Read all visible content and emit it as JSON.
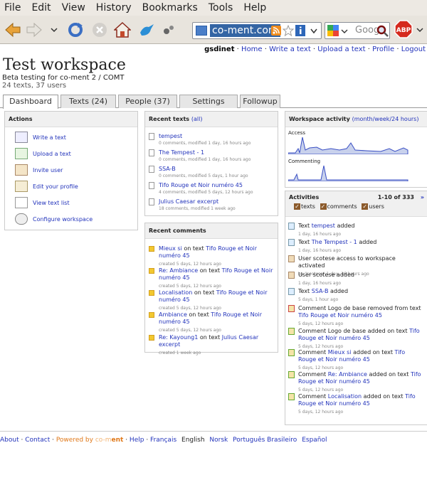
{
  "menu": [
    "File",
    "Edit",
    "View",
    "History",
    "Bookmarks",
    "Tools",
    "Help"
  ],
  "url": "co-ment.com",
  "search_placeholder": "Goog",
  "user": {
    "name": "gsdinet",
    "links": [
      "Home",
      "Write a text",
      "Upload a text",
      "Profile",
      "Logout"
    ]
  },
  "workspace": {
    "title": "Test workspace",
    "description": "Beta testing for co-ment 2 / COMT",
    "stats": "24 texts, 37 users"
  },
  "tabs": [
    "Dashboard",
    "Texts (24)",
    "People (37)",
    "Settings",
    "Followup"
  ],
  "actions": {
    "title": "Actions",
    "items": [
      "Write a text",
      "Upload a text",
      "Invite user",
      "Edit your profile",
      "View text list",
      "Configure workspace"
    ]
  },
  "recent_texts": {
    "title": "Recent texts",
    "all_link": "(all)",
    "items": [
      {
        "title": "tempest",
        "meta": "0 comments, modified 1 day, 16 hours ago"
      },
      {
        "title": "The Tempest - 1",
        "meta": "0 comments, modified 1 day, 16 hours ago"
      },
      {
        "title": "SSA-B",
        "meta": "0 comments, modified 5 days, 1 hour ago"
      },
      {
        "title": "Tifo Rouge et Noir numéro 45",
        "meta": "4 comments, modified 5 days, 12 hours ago"
      },
      {
        "title": "Julius Caesar excerpt",
        "meta": "18 comments, modified 1 week ago"
      }
    ]
  },
  "recent_comments": {
    "title": "Recent comments",
    "items": [
      {
        "comment": "Mieux si",
        "text": "Tifo Rouge et Noir numéro 45",
        "meta": "created 5 days, 12 hours ago"
      },
      {
        "comment": "Re: Ambiance",
        "text": "Tifo Rouge et Noir numéro 45",
        "meta": "created 5 days, 12 hours ago"
      },
      {
        "comment": "Localisation",
        "text": "Tifo Rouge et Noir numéro 45",
        "meta": "created 5 days, 12 hours ago"
      },
      {
        "comment": "Ambiance",
        "text": "Tifo Rouge et Noir numéro 45",
        "meta": "created 5 days, 12 hours ago"
      },
      {
        "comment": "Re: Kayoung1",
        "text": "Julius Caesar excerpt",
        "meta": "created 1 week ago"
      }
    ]
  },
  "labels": {
    "on_text": "on text",
    "added": "added"
  },
  "workspace_activity": {
    "title": "Workspace activity",
    "periods": "(month/week/24 hours)",
    "access_label": "Access",
    "commenting_label": "Commenting"
  },
  "activities": {
    "title": "Activities",
    "range": "1-10 of 333",
    "next": "»",
    "filters": [
      "texts",
      "comments",
      "users"
    ],
    "items": [
      {
        "prefix": "Text",
        "link": "tempest",
        "suffix": "added",
        "meta": "1 day, 16 hours ago"
      },
      {
        "prefix": "Text",
        "link": "The Tempest - 1",
        "suffix": "added",
        "meta": "1 day, 16 hours ago"
      },
      {
        "prefix": "User scotese access to workspace activated",
        "link": "",
        "suffix": "",
        "meta": "by \"scotese\" 1 day, 16 hours ago"
      },
      {
        "prefix": "User scotese added",
        "link": "",
        "suffix": "",
        "meta": "1 day, 16 hours ago"
      },
      {
        "prefix": "Text",
        "link": "SSA-B",
        "suffix": "added",
        "meta": "5 days, 1 hour ago"
      },
      {
        "prefix": "Comment Logo de base removed from text",
        "link": "Tifo Rouge et Noir numéro 45",
        "suffix": "",
        "meta": "5 days, 12 hours ago"
      },
      {
        "prefix": "Comment Logo de base added on text",
        "link": "Tifo Rouge et Noir numéro 45",
        "suffix": "",
        "meta": "5 days, 12 hours ago"
      },
      {
        "prefix": "Comment",
        "link": "Mieux si",
        "suffix": "added on text",
        "link2": "Tifo Rouge et Noir numéro 45",
        "meta": "5 days, 12 hours ago"
      },
      {
        "prefix": "Comment",
        "link": "Re: Ambiance",
        "suffix": "added on text",
        "link2": "Tifo Rouge et Noir numéro 45",
        "meta": "5 days, 12 hours ago"
      },
      {
        "prefix": "Comment",
        "link": "Localisation",
        "suffix": "added on text",
        "link2": "Tifo Rouge et Noir numéro 45",
        "meta": "5 days, 12 hours ago"
      }
    ]
  },
  "footer": {
    "links": [
      "About",
      "Contact"
    ],
    "powered_prefix": "Powered by",
    "brand_co": "co-m",
    "brand_ent": "ent",
    "help": "Help",
    "languages": [
      "Français",
      "English",
      "Norsk",
      "Português Brasileiro",
      "Español"
    ]
  }
}
